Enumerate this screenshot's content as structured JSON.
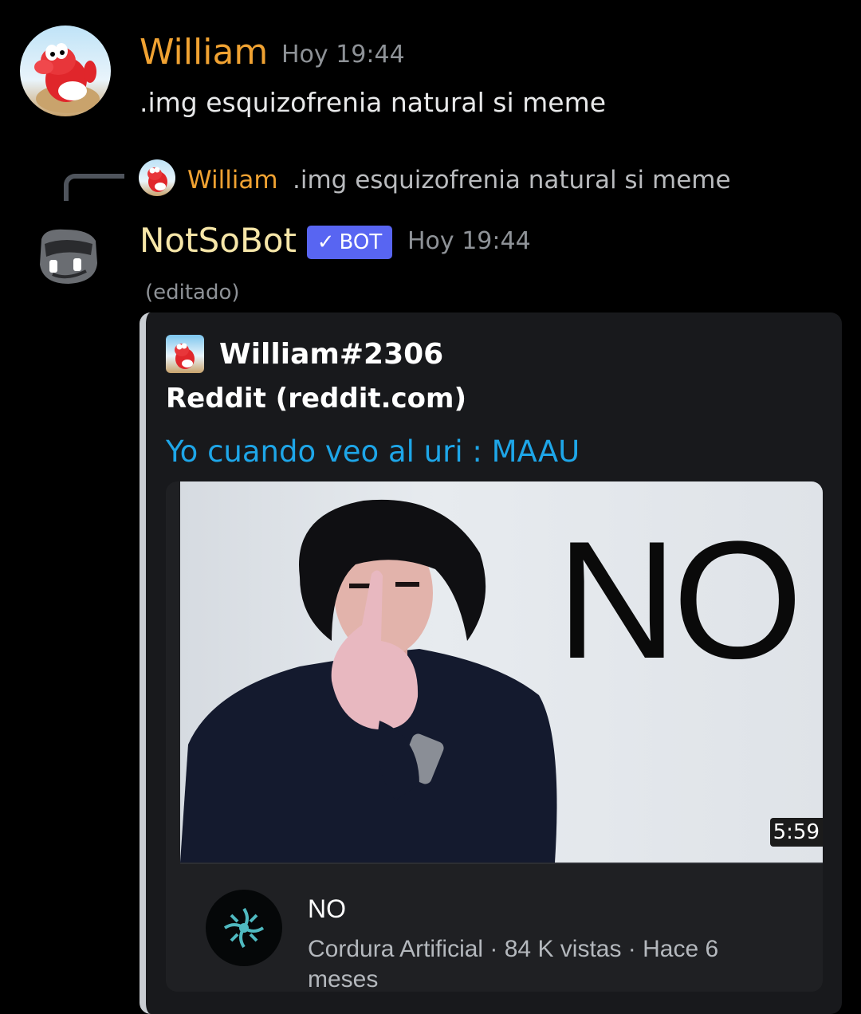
{
  "message1": {
    "username": "William",
    "timestamp": "Hoy 19:44",
    "content": ".img esquizofrenia natural si meme"
  },
  "reply": {
    "username": "William",
    "content": ".img esquizofrenia natural si meme"
  },
  "bot_message": {
    "username": "NotSoBot",
    "badge": "BOT",
    "badge_check": "✓",
    "timestamp": "Hoy 19:44",
    "edited": "(editado)",
    "embed": {
      "author": "William#2306",
      "provider": "Reddit (reddit.com)",
      "title": "Yo cuando veo al uri : MAAU",
      "video": {
        "overlay_text": "NO",
        "duration": "5:59",
        "title": "NO",
        "meta": "Cordura Artificial · 84 K vistas · Hace 6 meses"
      }
    }
  },
  "colors": {
    "background": "#000000",
    "username_orange": "#f0a232",
    "bot_name": "#f6e6a8",
    "bot_badge": "#5865f2",
    "embed_link": "#1ea6e8",
    "embed_bg": "#18191c"
  },
  "icons": [
    "yoshi-avatar",
    "notsobot-avatar",
    "reply-connector",
    "check-icon",
    "channel-avatar"
  ]
}
